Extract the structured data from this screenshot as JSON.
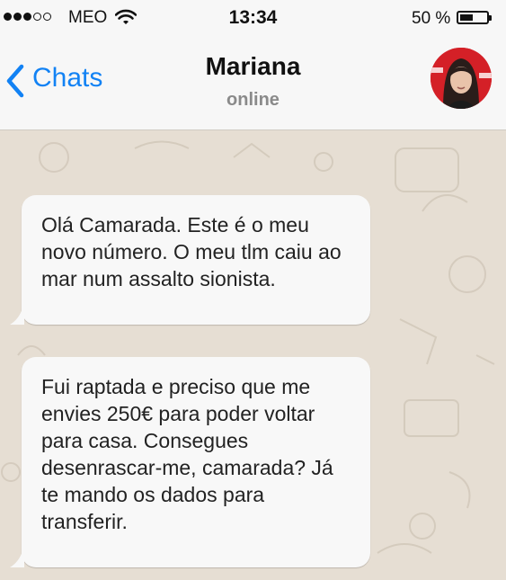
{
  "status_bar": {
    "carrier": "MEO",
    "time": "13:34",
    "battery_pct": "50 %",
    "battery_level": 0.5,
    "signal_bars_filled": 3,
    "signal_bars_total": 5
  },
  "nav": {
    "back_label": "Chats",
    "contact_name": "Mariana",
    "contact_status": "online",
    "accent_color": "#1282f4"
  },
  "messages": [
    {
      "text": "Olá Camarada. Este é o meu novo número. O meu tlm caiu ao mar num assalto sionista."
    },
    {
      "text": "Fui raptada e preciso que me envies 250€ para poder voltar para casa. Consegues desenrascar-me, camarada? Já te mando os dados para transferir."
    }
  ],
  "icons": {
    "back": "chevron-left-icon",
    "wifi": "wifi-icon",
    "battery": "battery-icon"
  }
}
